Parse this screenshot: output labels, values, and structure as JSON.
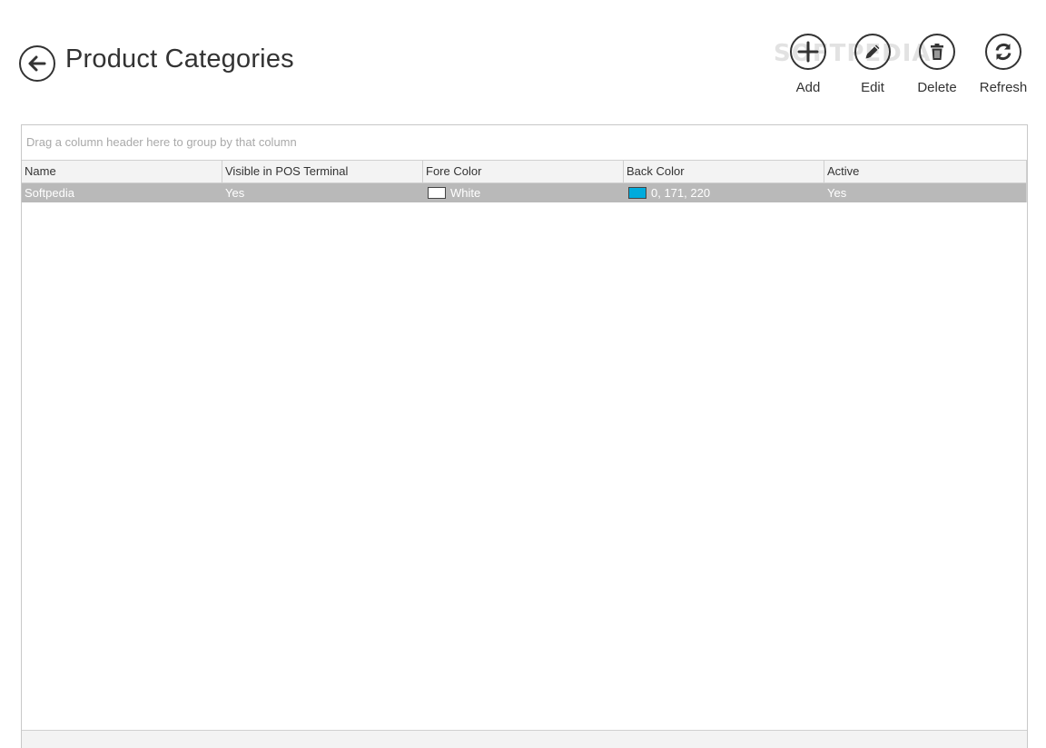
{
  "header": {
    "title": "Product Categories",
    "watermark": "SOFTPEDIA"
  },
  "toolbar": {
    "add_label": "Add",
    "edit_label": "Edit",
    "delete_label": "Delete",
    "refresh_label": "Refresh"
  },
  "grid": {
    "group_panel_hint": "Drag a column header here to group by that column",
    "columns": [
      "Name",
      "Visible in POS Terminal",
      "Fore Color",
      "Back Color",
      "Active"
    ],
    "rows": [
      {
        "name": "Softpedia",
        "visible": "Yes",
        "fore_color": "White",
        "back_color": "0, 171, 220",
        "active": "Yes"
      }
    ]
  },
  "colors": {
    "fore_swatch": "#ffffff",
    "back_swatch": "#00abdc",
    "selected_row": "#b9b9b9"
  },
  "icons": {
    "back": "arrow-left-circle-icon",
    "add": "plus-circle-icon",
    "edit": "pencil-circle-icon",
    "delete": "trash-circle-icon",
    "refresh": "refresh-circle-icon"
  }
}
